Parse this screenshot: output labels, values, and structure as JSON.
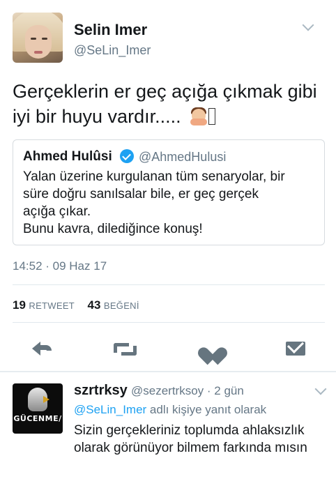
{
  "tweet": {
    "author_name": "Selin Imer",
    "author_handle": "@SeLin_Imer",
    "text": "Gerçeklerin er geç açığa çıkmak gibi iyi bir huyu vardır.....",
    "timestamp": "14:52 · 09 Haz 17",
    "retweets_count": "19",
    "retweets_label": "RETWEET",
    "likes_count": "43",
    "likes_label": "BEĞENİ"
  },
  "quoted": {
    "author_name": "Ahmed Hulûsi",
    "author_handle": "@AhmedHulusi",
    "lines": [
      "Yalan üzerine kurgulanan tüm senaryolar, bir",
      "süre doğru sanılsalar bile, er geç gerçek",
      "açığa çıkar.",
      "Bunu kavra, dilediğince konuş!"
    ]
  },
  "actions": {
    "reply": "reply-icon",
    "retweet": "retweet-icon",
    "like": "heart-icon",
    "message": "envelope-icon"
  },
  "reply": {
    "author_name": "szrtrksy",
    "author_handle": "@sezertrksoy",
    "time": "2 gün",
    "meta": "@sezertrksoy · 2 gün",
    "avatar_brand": "GÜCENME/",
    "context_mention": "@SeLin_Imer",
    "context_suffix": " adlı kişiye yanıt olarak",
    "text": "Sizin gerçekleriniz toplumda ahlaksızlık olarak görünüyor bilmem farkında mısın"
  },
  "colors": {
    "accent": "#1da1f2",
    "secondary_text": "#657786",
    "icon_gray": "#66757f"
  }
}
